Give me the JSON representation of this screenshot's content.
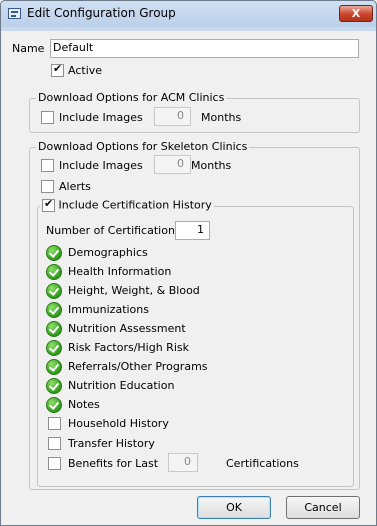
{
  "window": {
    "title": "Edit Configuration Group",
    "close_glyph": "X"
  },
  "name": {
    "label": "Name",
    "value": "Default"
  },
  "active": {
    "label": "Active",
    "checked": true
  },
  "acm": {
    "group_title": "Download Options for ACM Clinics",
    "include_images_label": "Include Images",
    "include_images_checked": false,
    "months_value": "0",
    "months_label": "Months"
  },
  "skeleton": {
    "group_title": "Download Options for Skeleton Clinics",
    "include_images_label": "Include Images",
    "include_images_checked": false,
    "months_value": "0",
    "months_label": "Months",
    "alerts_label": "Alerts",
    "alerts_checked": false,
    "cert": {
      "label": "Include Certification History",
      "checked": true,
      "num_label": "Number of Certifications",
      "num_value": "1",
      "items": [
        {
          "label": "Demographics",
          "status": "check-icon"
        },
        {
          "label": "Health Information",
          "status": "check-icon"
        },
        {
          "label": "Height, Weight, & Blood",
          "status": "check-icon"
        },
        {
          "label": "Immunizations",
          "status": "check-icon"
        },
        {
          "label": "Nutrition Assessment",
          "status": "check-icon"
        },
        {
          "label": "Risk Factors/High Risk",
          "status": "check-icon"
        },
        {
          "label": "Referrals/Other Programs",
          "status": "check-icon"
        },
        {
          "label": "Nutrition Education",
          "status": "check-icon"
        },
        {
          "label": "Notes",
          "status": "check-icon"
        }
      ],
      "household_label": "Household History",
      "transfer_label": "Transfer History",
      "benefits_label": "Benefits for Last",
      "benefits_value": "0",
      "certifications_label": "Certifications"
    }
  },
  "buttons": {
    "ok": "OK",
    "cancel": "Cancel"
  }
}
